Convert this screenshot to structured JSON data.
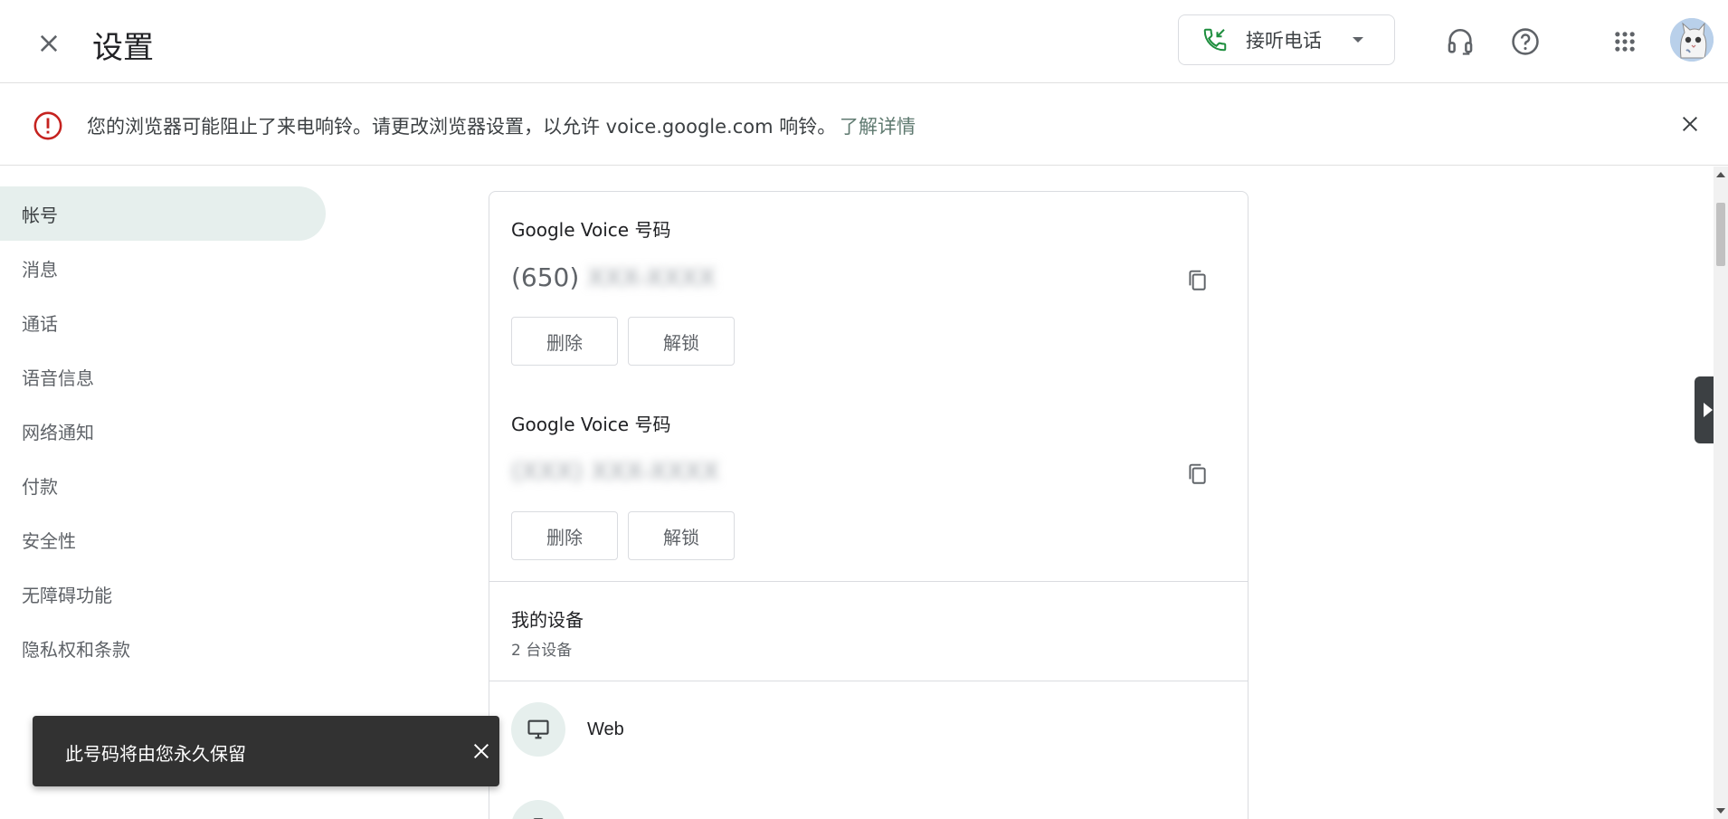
{
  "header": {
    "title": "设置",
    "call_button_label": "接听电话"
  },
  "banner": {
    "message": "您的浏览器可能阻止了来电响铃。请更改浏览器设置，以允许 voice.google.com 响铃。",
    "learn_more": "了解详情"
  },
  "sidebar": {
    "items": [
      {
        "label": "帐号",
        "active": true
      },
      {
        "label": "消息"
      },
      {
        "label": "通话"
      },
      {
        "label": "语音信息"
      },
      {
        "label": "网络通知"
      },
      {
        "label": "付款"
      },
      {
        "label": "安全性"
      },
      {
        "label": "无障碍功能"
      },
      {
        "label": "隐私权和条款"
      }
    ]
  },
  "numbers": [
    {
      "title": "Google Voice 号码",
      "area": "(650)",
      "rest_blurred": "XXX-XXXX",
      "delete_label": "删除",
      "unlock_label": "解锁"
    },
    {
      "title": "Google Voice 号码",
      "area": "",
      "rest_blurred": "(XXX) XXX-XXXX",
      "delete_label": "删除",
      "unlock_label": "解锁"
    }
  ],
  "devices": {
    "title": "我的设备",
    "count": "2 台设备",
    "items": [
      {
        "name": "Web",
        "icon": "monitor-icon"
      },
      {
        "name": "",
        "icon": "phone-icon"
      }
    ]
  },
  "snackbar": {
    "text": "此号码将由您永久保留"
  },
  "colors": {
    "accent": "#1e8e3e",
    "active_nav_bg": "#e6efed",
    "error_red": "#c5221f"
  }
}
